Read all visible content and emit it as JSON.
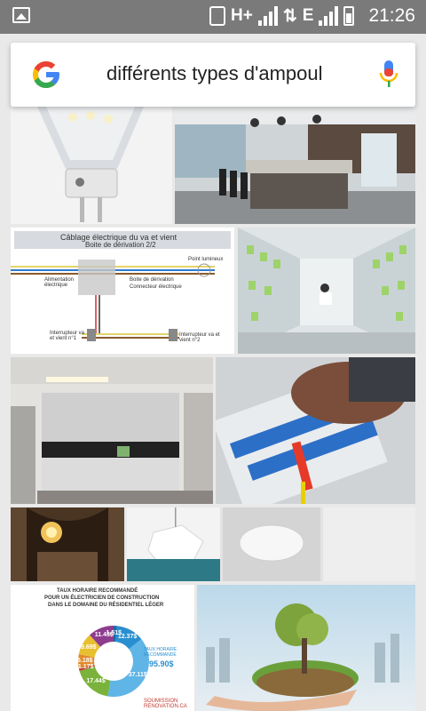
{
  "status_bar": {
    "network_type": "H+",
    "network_type_2": "E",
    "time": "21:26"
  },
  "search": {
    "query": "différents types d'ampoul"
  },
  "results": {
    "diagram": {
      "title_line1": "Câblage électrique du va et vient",
      "title_line2": "Boite de dérivation 2/2",
      "label_lamp": "Point lumineux",
      "label_supply": "Alimentation électrique",
      "label_box": "Boite de dérivation",
      "label_connector": "Connecteur électrique",
      "label_switch1": "Interrupteur va et vient n°1",
      "label_switch2": "Interrupteur va et vient n°2"
    },
    "infographic": {
      "title_line1": "TAUX HORAIRE RECOMMANDÉ",
      "title_line2": "POUR UN ÉLECTRICIEN DE CONSTRUCTION",
      "title_line3": "DANS LE DOMAINE DU RÉSIDENTIEL LÉGER",
      "slices": [
        {
          "label": "1.51$",
          "value": 1.51,
          "color": "#1b6aa8"
        },
        {
          "label": "12.37$",
          "value": 12.37,
          "color": "#2a8fd0"
        },
        {
          "label": "37.11$",
          "value": 37.11,
          "color": "#5fb5e6"
        },
        {
          "label": "17.44$",
          "value": 17.44,
          "color": "#7ab23b"
        },
        {
          "label": "1.17$",
          "value": 1.17,
          "color": "#c33a2f"
        },
        {
          "label": "6.18$",
          "value": 6.18,
          "color": "#e08a2d"
        },
        {
          "label": "9.69$",
          "value": 9.69,
          "color": "#e8c02f"
        },
        {
          "label": "11.43$",
          "value": 11.43,
          "color": "#8e3d8e"
        }
      ],
      "total_label": "TAUX HORAIRE RECOMMANDÉ",
      "total_value": "95.90$",
      "brand": "SOUMISSION RENOVATION.CA"
    }
  },
  "colors": {
    "status_bar": "#7a7a7a",
    "google_blue": "#4285F4",
    "google_red": "#EA4335",
    "google_yellow": "#FBBC05",
    "google_green": "#34A853"
  }
}
